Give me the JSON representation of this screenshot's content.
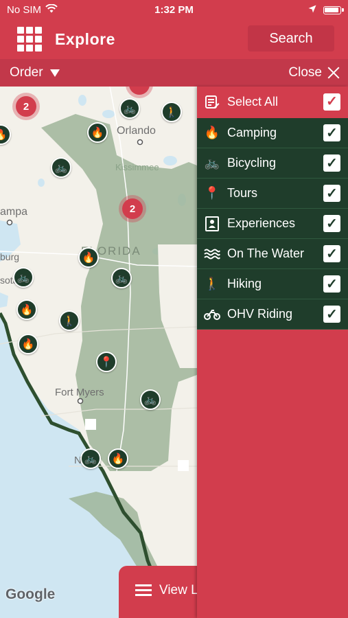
{
  "status_bar": {
    "carrier": "No SIM",
    "time": "1:32 PM"
  },
  "header": {
    "title": "Explore",
    "search_label": "Search"
  },
  "order_bar": {
    "order_label": "Order",
    "close_label": "Close"
  },
  "map": {
    "labels": {
      "orlando": "Orlando",
      "kissimmee": "Kissimmee",
      "tampa": "ampa",
      "florida": "FLORIDA",
      "burg": "burg",
      "sota": "sota",
      "fort_myers": "Fort Myers",
      "naples": "N"
    },
    "clusters": {
      "top_left": "2",
      "center": "2"
    },
    "attribution": "Google"
  },
  "view_list": {
    "label": "View List"
  },
  "filter_panel": {
    "select_all": {
      "label": "Select All",
      "icon": "clipboard-edit-icon",
      "checked": true
    },
    "items": [
      {
        "label": "Camping",
        "icon": "campfire-icon",
        "checked": true
      },
      {
        "label": "Bicycling",
        "icon": "bicycle-icon",
        "checked": true
      },
      {
        "label": "Tours",
        "icon": "map-pin-route-icon",
        "checked": true
      },
      {
        "label": "Experiences",
        "icon": "experience-badge-icon",
        "checked": true
      },
      {
        "label": "On The Water",
        "icon": "waves-icon",
        "checked": true
      },
      {
        "label": "Hiking",
        "icon": "hiker-icon",
        "checked": true
      },
      {
        "label": "OHV Riding",
        "icon": "atv-icon",
        "checked": true
      }
    ]
  },
  "colors": {
    "brand_red": "#d23d4d",
    "forest_green": "#1f3d2b",
    "water": "#cfe6f2",
    "land": "#f3f1ea",
    "park_green": "#9fb59a"
  }
}
